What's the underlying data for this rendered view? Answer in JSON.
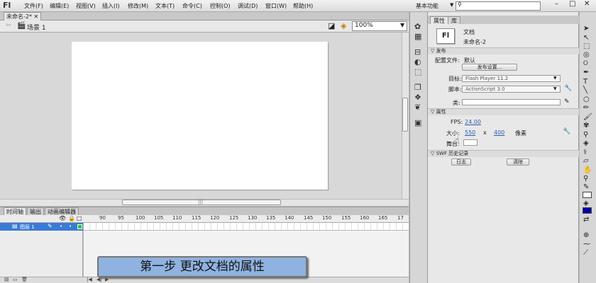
{
  "app": {
    "logo": "Fl"
  },
  "menu": [
    "文件(F)",
    "编辑(E)",
    "视图(V)",
    "插入(I)",
    "修改(M)",
    "文本(T)",
    "命令(C)",
    "控制(O)",
    "调试(D)",
    "窗口(W)",
    "帮助(H)"
  ],
  "workspace": {
    "label": "基本功能",
    "search_placeholder": ""
  },
  "document": {
    "tab_label": "未命名-2*",
    "scene_label": "场景 1",
    "zoom": "100%"
  },
  "timeline": {
    "tabs": [
      "时间轴",
      "输出",
      "动画编辑器"
    ],
    "ticks": [
      "90",
      "95",
      "100",
      "105",
      "110",
      "115",
      "120",
      "125",
      "130",
      "135",
      "140",
      "145",
      "150",
      "155",
      "160",
      "165",
      "17"
    ],
    "layer_name": "图层 1"
  },
  "caption": "第一步  更改文档的属性",
  "properties": {
    "tabs": [
      "属性",
      "库"
    ],
    "doc_type": "文档",
    "doc_name": "未命名-2",
    "publish_section": "发布",
    "profile_label": "配置文件:",
    "profile_value": "默认",
    "publish_settings_button": "发布设置...",
    "target_label": "目标:",
    "target_value": "Flash Player 11.2",
    "script_label": "脚本:",
    "script_value": "ActionScript 3.0",
    "class_label": "类:",
    "attributes_section": "属性",
    "fps_label": "FPS:",
    "fps_value": "24.00",
    "size_label": "大小:",
    "width": "550",
    "times": "x",
    "height": "400",
    "unit": "像素",
    "stage_label": "舞台:",
    "swf_section": "SWF 历史记录",
    "log_button": "日志",
    "clear_button": "清除"
  },
  "colors": {
    "layer_selected": "#3a7bd5",
    "caption_bg": "#8fb2e0",
    "fill_color": "#0000aa"
  }
}
